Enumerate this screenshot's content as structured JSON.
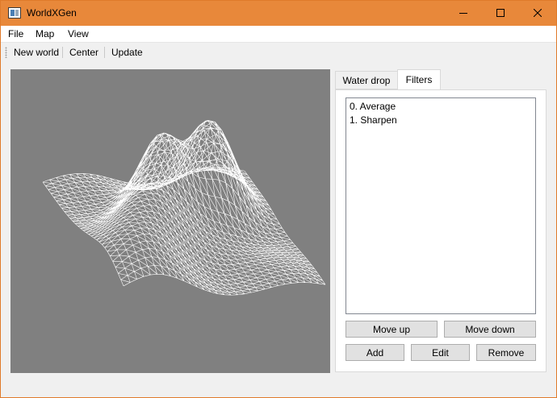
{
  "window": {
    "title": "WorldXGen"
  },
  "menu": {
    "file": "File",
    "map": "Map",
    "view": "View"
  },
  "toolbar": {
    "new_world": "New world",
    "center": "Center",
    "update": "Update"
  },
  "tabs": [
    {
      "label": "Water drop",
      "active": false
    },
    {
      "label": "Filters",
      "active": true
    }
  ],
  "filters": {
    "items": [
      "0. Average",
      "1. Sharpen"
    ],
    "buttons": {
      "move_up": "Move up",
      "move_down": "Move down",
      "add": "Add",
      "edit": "Edit",
      "remove": "Remove"
    }
  },
  "colors": {
    "titlebar": "#e8883a",
    "viewport_bg": "#808080",
    "mesh": "#ffffff"
  },
  "icons": {
    "app": "app-window-icon",
    "minimize": "minimize-icon",
    "maximize": "maximize-icon",
    "close": "close-icon"
  }
}
